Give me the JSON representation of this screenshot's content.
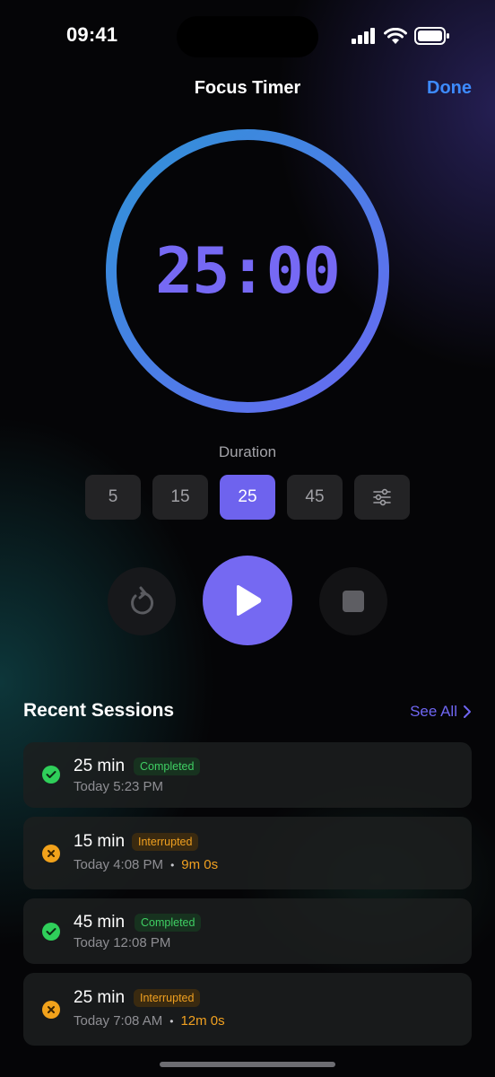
{
  "status_bar": {
    "time": "09:41"
  },
  "nav": {
    "title": "Focus Timer",
    "done_label": "Done"
  },
  "timer": {
    "display": "25:00",
    "progress": 1.0
  },
  "duration": {
    "label": "Duration",
    "presets": [
      "5",
      "15",
      "25",
      "45"
    ],
    "selected": "25"
  },
  "controls": {
    "reset_icon": "reset-icon",
    "play_icon": "play-icon",
    "stop_icon": "stop-icon"
  },
  "recent": {
    "title": "Recent Sessions",
    "see_all": "See All",
    "sessions": [
      {
        "duration": "25 min",
        "status": "Completed",
        "time": "Today 5:23 PM",
        "partial": ""
      },
      {
        "duration": "15 min",
        "status": "Interrupted",
        "time": "Today 4:08 PM",
        "partial": "9m 0s"
      },
      {
        "duration": "45 min",
        "status": "Completed",
        "time": "Today 12:08 PM",
        "partial": ""
      },
      {
        "duration": "25 min",
        "status": "Interrupted",
        "time": "Today 7:08 AM",
        "partial": "12m 0s"
      }
    ]
  },
  "colors": {
    "accent": "#7569f2",
    "done_blue": "#3d8bff",
    "completed_green": "#2fcf5a",
    "interrupted_orange": "#f2a21b"
  }
}
